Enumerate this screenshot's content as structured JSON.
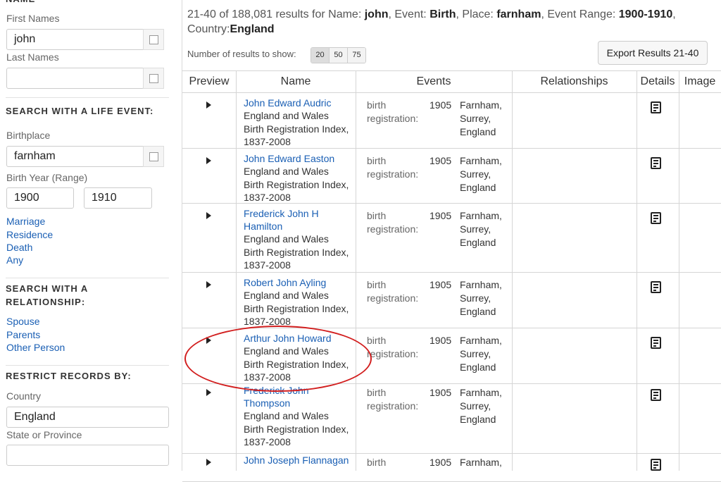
{
  "sidebar": {
    "name_heading": "NAME",
    "first_names_label": "First Names",
    "first_names_value": "john",
    "last_names_label": "Last Names",
    "last_names_value": "",
    "life_event_heading": "SEARCH WITH A LIFE EVENT:",
    "birthplace_label": "Birthplace",
    "birthplace_value": "farnham",
    "birth_year_label": "Birth Year (Range)",
    "birth_year_from": "1900",
    "birth_year_to": "1910",
    "event_links": [
      "Marriage",
      "Residence",
      "Death",
      "Any"
    ],
    "relationship_heading": "SEARCH WITH A RELATIONSHIP:",
    "relationship_links": [
      "Spouse",
      "Parents",
      "Other Person"
    ],
    "restrict_heading": "RESTRICT RECORDS BY:",
    "country_label": "Country",
    "country_value": "England",
    "state_label": "State or Province",
    "state_value": ""
  },
  "summary": {
    "range": "21-40 of 188,081 results for",
    "name_label": "Name:",
    "name_value": "john",
    "event_label": "Event:",
    "event_value": "Birth",
    "place_label": "Place:",
    "place_value": "farnham",
    "event_range_label": "Event Range:",
    "event_range_value": "1900-1910",
    "country_label": "Country:",
    "country_value": "England"
  },
  "results_count": {
    "label": "Number of results to show:",
    "options": [
      "20",
      "50",
      "75"
    ],
    "selected": "20"
  },
  "export_label": "Export Results 21-40",
  "table": {
    "headers": [
      "Preview",
      "Name",
      "Events",
      "Relationships",
      "Details",
      "Image"
    ],
    "rows": [
      {
        "name": [
          "John Edward Audric"
        ],
        "collection": [
          "England and Wales",
          "Birth Registration Index,",
          "1837-2008"
        ],
        "event_type": [
          "birth",
          "registration:"
        ],
        "year": "1905",
        "place": [
          "Farnham,",
          "Surrey,",
          "England"
        ]
      },
      {
        "name": [
          "John Edward Easton"
        ],
        "collection": [
          "England and Wales",
          "Birth Registration Index,",
          "1837-2008"
        ],
        "event_type": [
          "birth",
          "registration:"
        ],
        "year": "1905",
        "place": [
          "Farnham,",
          "Surrey,",
          "England"
        ]
      },
      {
        "name": [
          "Frederick John H",
          "Hamilton"
        ],
        "collection": [
          "England and Wales",
          "Birth Registration Index,",
          "1837-2008"
        ],
        "event_type": [
          "birth",
          "registration:"
        ],
        "year": "1905",
        "place": [
          "Farnham,",
          "Surrey,",
          "England"
        ]
      },
      {
        "name": [
          "Robert John Ayling"
        ],
        "collection": [
          "England and Wales",
          "Birth Registration Index,",
          "1837-2008"
        ],
        "event_type": [
          "birth",
          "registration:"
        ],
        "year": "1905",
        "place": [
          "Farnham,",
          "Surrey,",
          "England"
        ]
      },
      {
        "name": [
          "Arthur John Howard"
        ],
        "collection": [
          "England and Wales",
          "Birth Registration Index,",
          "1837-2008"
        ],
        "event_type": [
          "birth",
          "registration:"
        ],
        "year": "1905",
        "place": [
          "Farnham,",
          "Surrey,",
          "England"
        ]
      },
      {
        "name": [
          "Frederick John",
          "Thompson"
        ],
        "collection": [
          "England and Wales",
          "Birth Registration Index,",
          "1837-2008"
        ],
        "event_type": [
          "birth",
          "registration:"
        ],
        "year": "1905",
        "place": [
          "Farnham,",
          "Surrey,",
          "England"
        ]
      },
      {
        "name": [
          "John Joseph Flannagan"
        ],
        "collection": [],
        "event_type": [
          "birth"
        ],
        "year": "1905",
        "place": [
          "Farnham,"
        ]
      }
    ]
  },
  "colors": {
    "link": "#1a5fb4",
    "highlight_circle": "#d21f1f"
  }
}
